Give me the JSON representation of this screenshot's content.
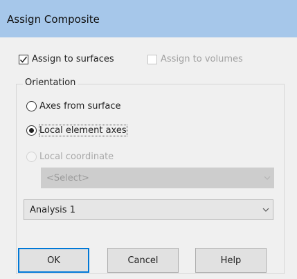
{
  "window": {
    "title": "Assign Composite"
  },
  "checks": {
    "surfaces": {
      "label": "Assign to surfaces",
      "checked": true
    },
    "volumes": {
      "label": "Assign to volumes",
      "checked": false,
      "disabled": true
    }
  },
  "orientation": {
    "group_label": "Orientation",
    "options": [
      {
        "label": "Axes from surface",
        "selected": false
      },
      {
        "label": "Local element axes",
        "selected": true
      },
      {
        "label": "Local coordinate",
        "selected": false,
        "disabled": true
      }
    ],
    "coordinate_select": {
      "value": "<Select>",
      "disabled": true
    },
    "analysis_select": {
      "value": "Analysis 1"
    }
  },
  "buttons": {
    "ok": "OK",
    "cancel": "Cancel",
    "help": "Help"
  },
  "icons": {
    "check": "checkmark-icon",
    "dropdown": "chevron-down-icon"
  }
}
